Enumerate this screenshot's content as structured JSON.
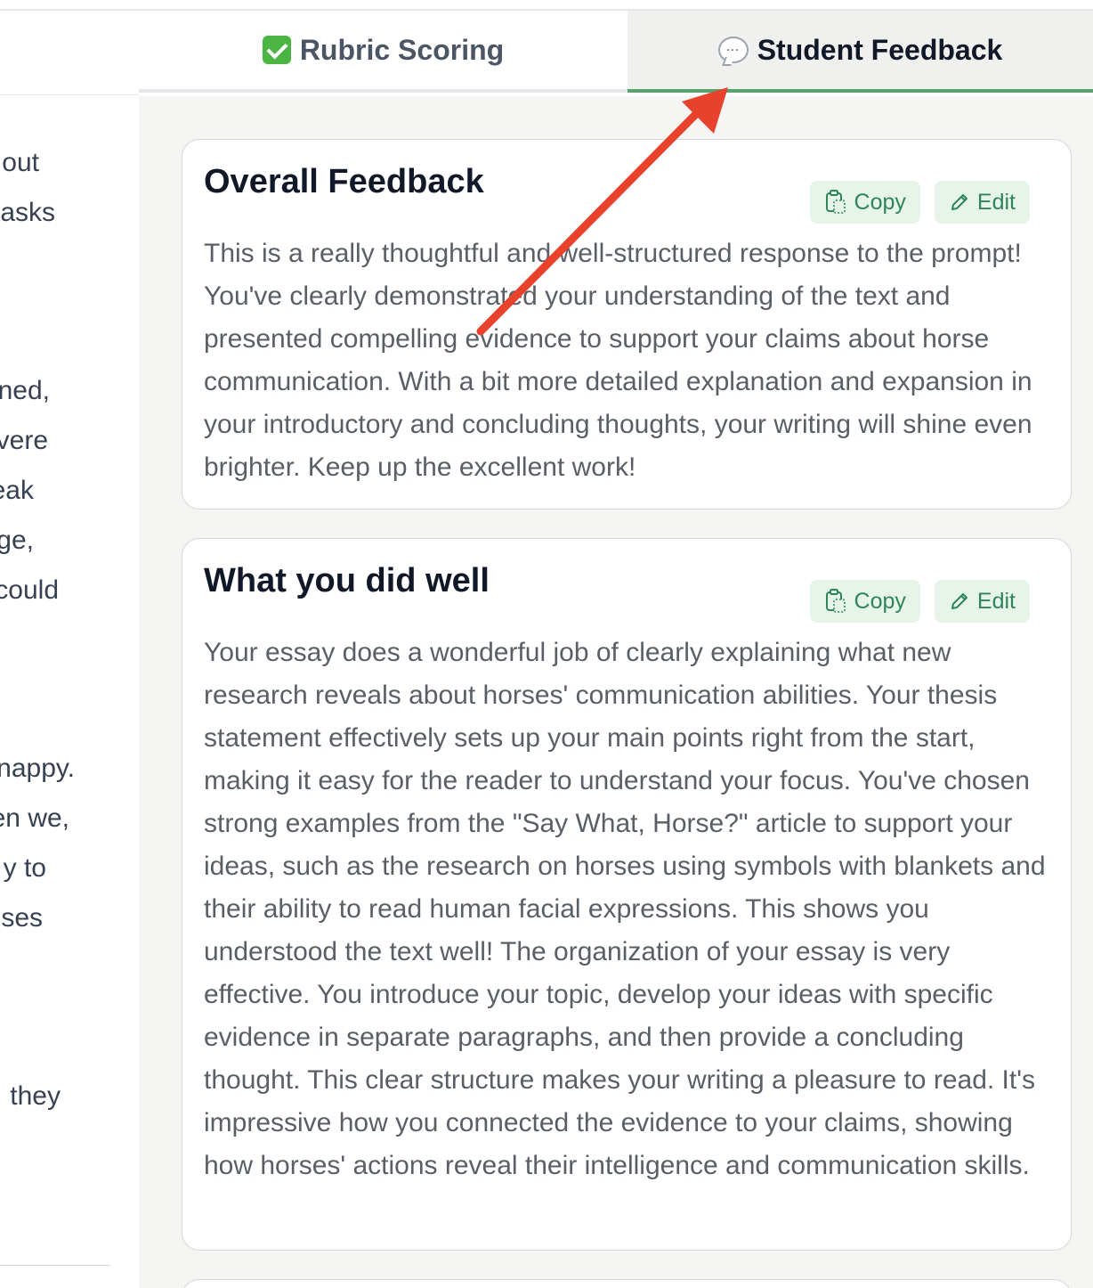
{
  "tabs": [
    {
      "label": "Rubric Scoring",
      "icon": "check-box-icon",
      "active": false
    },
    {
      "label": "Student Feedback",
      "icon": "speech-bubble-icon",
      "active": true
    }
  ],
  "left_fragments": [
    "out",
    "asks",
    "ned,",
    "vere",
    "eak",
    "ge,",
    "could",
    "nappy.",
    "en we,",
    "y to",
    "ses",
    "they"
  ],
  "cards": [
    {
      "title": "Overall Feedback",
      "copy_label": "Copy",
      "edit_label": "Edit",
      "text": "This is a really thoughtful and well-structured response to the prompt! You've clearly demonstrated your understanding of the text and presented compelling evidence to support your claims about horse communication. With a bit more detailed explanation and expansion in your introductory and concluding thoughts, your writing will shine even brighter. Keep up the excellent work!"
    },
    {
      "title": "What you did well",
      "copy_label": "Copy",
      "edit_label": "Edit",
      "text": "Your essay does a wonderful job of clearly explaining what new research reveals about horses' communication abilities. Your thesis statement effectively sets up your main points right from the start, making it easy for the reader to understand your focus. You've chosen strong examples from the \"Say What, Horse?\" article to support your ideas, such as the research on horses using symbols with blankets and their ability to read human facial expressions. This shows you understood the text well! The organization of your essay is very effective. You introduce your topic, develop your ideas with specific evidence in separate paragraphs, and then provide a concluding thought. This clear structure makes your writing a pleasure to read. It's impressive how you connected the evidence to your claims, showing how horses' actions reveal their intelligence and communication skills."
    }
  ],
  "colors": {
    "accent_green": "#5aa371",
    "button_bg": "#e6f4ea",
    "button_text": "#2f855a",
    "annotation_arrow": "#e8412c"
  }
}
